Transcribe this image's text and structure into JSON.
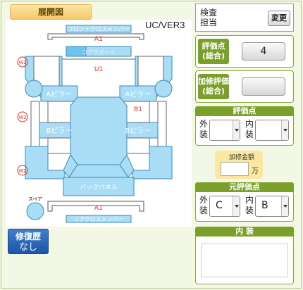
{
  "left": {
    "tab_title": "展開図",
    "model_label": "UC/VER3",
    "history_button": {
      "line1": "修復歴",
      "line2": "なし"
    },
    "diagram": {
      "front_cross_member": "フロントクロスメンバー",
      "core_support": "コアサポート",
      "back_panel": "バックパネル",
      "rear_cross_member": "リアクロスメンバー",
      "a_pillar_left": "Aピラー",
      "a_pillar_right": "Aピラー",
      "b_pillar_left": "Bピラー",
      "b_pillar_right": "Bピラー",
      "spare_label": "スペア",
      "marks": {
        "a1_top": "A1",
        "u1": "U1",
        "w2_1": "W2",
        "w2_2": "W2",
        "w2_3": "W2",
        "b1": "B1",
        "a1_bottom": "A1"
      }
    }
  },
  "right": {
    "inspector": {
      "label_line1": "検査",
      "label_line2": "担当",
      "button": "変更"
    },
    "overall_score": {
      "label_line1": "評価点",
      "label_line2": "(総合)",
      "value": "4"
    },
    "repair_score": {
      "label_line1": "加修評価",
      "label_line2": "(総合)",
      "value": ""
    },
    "score_section": {
      "title": "評価点",
      "exterior_label_1": "外",
      "exterior_label_2": "装",
      "exterior_value": "",
      "interior_label_1": "内",
      "interior_label_2": "装",
      "interior_value": ""
    },
    "repair_amount": {
      "label": "加修金額",
      "value": "",
      "unit": "万"
    },
    "original_section": {
      "title": "元評価点",
      "exterior_label_1": "外",
      "exterior_label_2": "装",
      "exterior_value": "C",
      "interior_label_1": "内",
      "interior_label_2": "装",
      "interior_value": "B"
    },
    "interior_section": {
      "title": "内 装",
      "text": ""
    }
  },
  "colors": {
    "part_fill": "#a9dcf5",
    "part_stroke": "#3a8ab8",
    "accent_green": "#7aa02a",
    "mark_red": "#d9352a",
    "button_blue": "#1d55a4"
  }
}
